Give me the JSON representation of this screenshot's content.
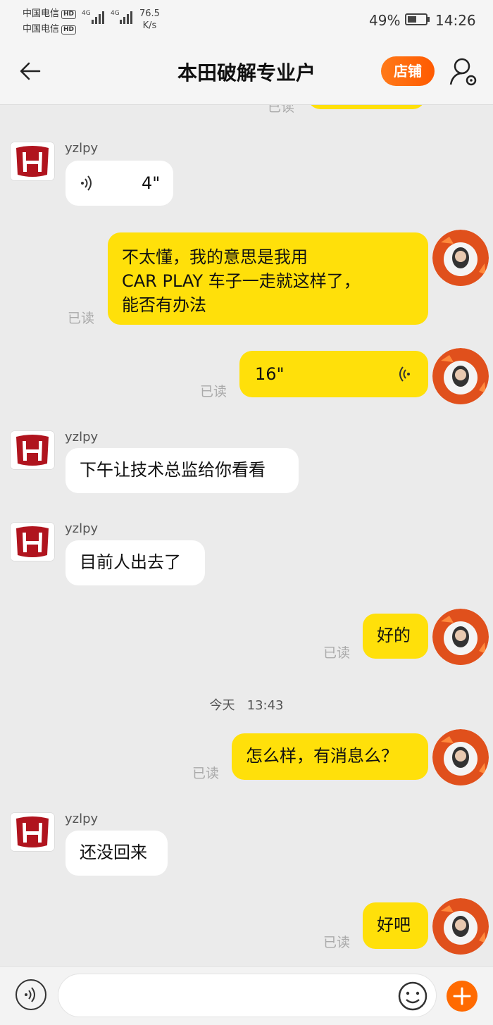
{
  "status_bar": {
    "carrier1": "中国电信",
    "carrier2": "中国电信",
    "hd": "HD",
    "network": "4G",
    "speed_value": "76.5",
    "speed_unit": "K/s",
    "battery_percent": "49%",
    "battery_level": 0.49,
    "time": "14:26"
  },
  "header": {
    "title": "本田破解专业户",
    "shop_button": "店铺"
  },
  "chat": {
    "read_label": "已读",
    "contact_name": "yzlpy",
    "messages": [
      {
        "type": "voice",
        "side": "left",
        "name": "yzlpy",
        "duration": "4\""
      },
      {
        "type": "text",
        "side": "right",
        "text1": "不太懂，我的意思是我用",
        "text2": "CAR  PLAY  车子一走就这样了，",
        "text3": "能否有办法",
        "status": "已读"
      },
      {
        "type": "voice",
        "side": "right",
        "duration": "16\"",
        "status": "已读"
      },
      {
        "type": "text",
        "side": "left",
        "name": "yzlpy",
        "text": "下午让技术总监给你看看"
      },
      {
        "type": "text",
        "side": "left",
        "name": "yzlpy",
        "text": "目前人出去了"
      },
      {
        "type": "text",
        "side": "right",
        "text": "好的",
        "status": "已读"
      },
      {
        "type": "time",
        "day": "今天",
        "time": "13:43"
      },
      {
        "type": "text",
        "side": "right",
        "text": "怎么样，有消息么？",
        "status": "已读"
      },
      {
        "type": "text",
        "side": "left",
        "name": "yzlpy",
        "text": "还没回来"
      },
      {
        "type": "text",
        "side": "right",
        "text": "好吧",
        "status": "已读"
      }
    ]
  },
  "colors": {
    "accent_orange": "#ff6a00",
    "bubble_yellow": "#ffe00a",
    "honda_red": "#b0141e"
  },
  "icons": [
    "back-arrow-icon",
    "user-settings-icon",
    "voice-wave-icon",
    "microphone-icon",
    "emoji-icon",
    "plus-icon",
    "honda-logo-icon"
  ]
}
